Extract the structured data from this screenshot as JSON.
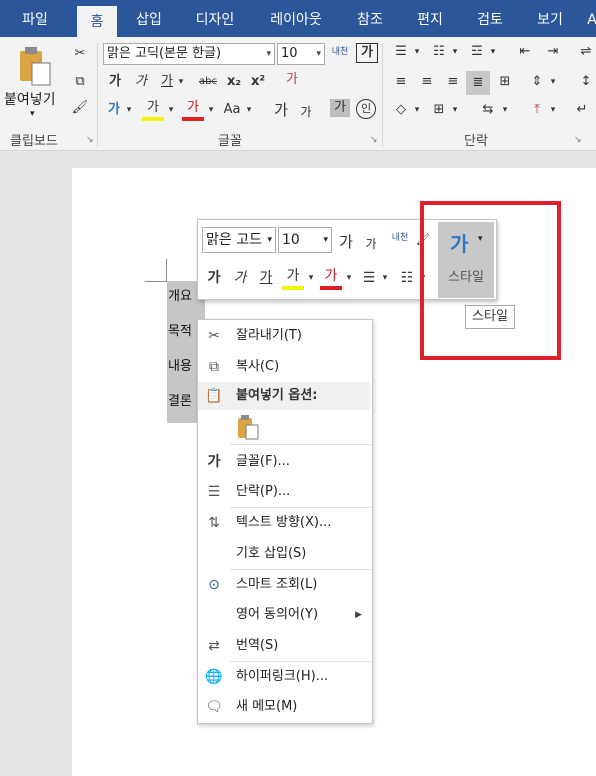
{
  "tabs": [
    "파일",
    "홈",
    "삽입",
    "디자인",
    "레이아웃",
    "참조",
    "편지",
    "검토",
    "보기",
    "A"
  ],
  "ribbon": {
    "clipboard": {
      "paste_label": "붙여넣기",
      "group_label": "클립보드"
    },
    "font": {
      "font_name": "맑은 고딕(본문 한글)",
      "font_size": "10",
      "group_label": "글꼴",
      "phonetic_label": "내천",
      "char_border": "가",
      "bold": "가",
      "italic": "가",
      "underline": "가",
      "strike": "abc",
      "subscript": "x₂",
      "superscript": "x²",
      "clear_format": "가",
      "text_effect": "가",
      "highlight": "가",
      "font_color": "가",
      "change_case": "Aa",
      "grow": "가",
      "shrink": "가",
      "shading": "가",
      "enclose": "인"
    },
    "paragraph": {
      "group_label": "단락"
    }
  },
  "document": {
    "paragraphs": [
      "개요",
      "목적",
      "내용",
      "결론"
    ]
  },
  "minibar": {
    "font_name": "맑은 고드",
    "font_size": "10",
    "grow": "가",
    "shrink": "가",
    "phonetic": "내천",
    "bold": "가",
    "italic": "가",
    "underline": "가",
    "highlight": "가",
    "font_color": "가",
    "style_label": "스타일"
  },
  "tooltip": "스타일",
  "context_menu": {
    "items": [
      {
        "label": "잘라내기(T)",
        "icon": "scissors-icon"
      },
      {
        "label": "복사(C)",
        "icon": "copy-icon"
      },
      {
        "label": "붙여넣기 옵션:",
        "icon": "paste-icon"
      },
      {
        "label": "가",
        "icon": "font-icon",
        "text": "글꼴(F)..."
      },
      {
        "label": "단락(P)...",
        "icon": "paragraph-icon"
      },
      {
        "label": "텍스트 방향(X)...",
        "icon": "text-direction-icon"
      },
      {
        "label": "기호 삽입(S)",
        "icon": ""
      },
      {
        "label": "스마트 조회(L)",
        "icon": "smart-lookup-icon"
      },
      {
        "label": "영어 동의어(Y)",
        "icon": ""
      },
      {
        "label": "번역(S)",
        "icon": "translate-icon"
      },
      {
        "label": "하이퍼링크(H)...",
        "icon": "hyperlink-icon"
      },
      {
        "label": "새 메모(M)",
        "icon": "new-comment-icon"
      }
    ],
    "font_glyph": "가",
    "font_label": "글꼴(F)..."
  },
  "colors": {
    "tabbar": "#2b579a",
    "highlight_box": "#e0202c"
  }
}
